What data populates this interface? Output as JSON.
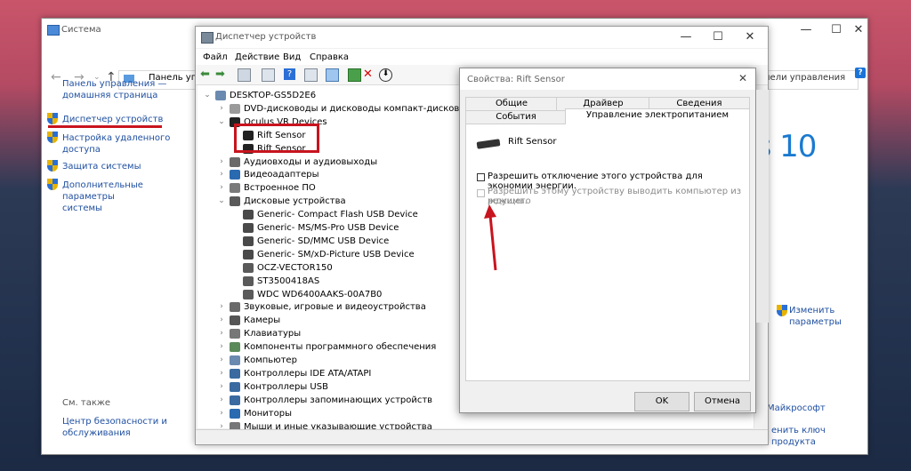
{
  "system": {
    "title": "Система",
    "address": "Панель упр",
    "search_fragment": "нели управления",
    "left_links": [
      "Панель управления —",
      "домашняя страница"
    ],
    "nav": [
      {
        "label1": "Диспетчер устройств",
        "label2": ""
      },
      {
        "label1": "Настройка удаленного",
        "label2": "доступа"
      },
      {
        "label1": "Защита системы",
        "label2": ""
      },
      {
        "label1": "Дополнительные параметры",
        "label2": "системы"
      }
    ],
    "see_also": "См. также",
    "bottom_link": [
      "Центр безопасности и",
      "обслуживания"
    ],
    "logo_text": "ows 10",
    "change_params": [
      "Изменить",
      "параметры"
    ],
    "microsoft_fragment": "Майкрософт",
    "product_key_fragment": "енить ключ продукта"
  },
  "devmgr": {
    "title": "Диспетчер устройств",
    "menu": [
      "Файл",
      "Действие",
      "Вид",
      "Справка"
    ],
    "tree": [
      {
        "label": "DESKTOP-GS5D2E6",
        "indent": 0,
        "expander": "expanded",
        "icon": "computer-icon"
      },
      {
        "label": "DVD-дисководы и дисководы компакт-дисков",
        "indent": 1,
        "expander": "collapsed",
        "icon": "dvd-drive-icon"
      },
      {
        "label": "Oculus VR Devices",
        "indent": 1,
        "expander": "expanded",
        "icon": "usb-device-icon"
      },
      {
        "label": "Rift Sensor",
        "indent": 2,
        "expander": "none",
        "icon": "usb-device-icon"
      },
      {
        "label": "Rift Sensor",
        "indent": 2,
        "expander": "none",
        "icon": "usb-device-icon"
      },
      {
        "label": "Аудиовходы и аудиовыходы",
        "indent": 1,
        "expander": "collapsed",
        "icon": "speaker-icon"
      },
      {
        "label": "Видеоадаптеры",
        "indent": 1,
        "expander": "collapsed",
        "icon": "display-adapter-icon"
      },
      {
        "label": "Встроенное ПО",
        "indent": 1,
        "expander": "collapsed",
        "icon": "firmware-icon"
      },
      {
        "label": "Дисковые устройства",
        "indent": 1,
        "expander": "expanded",
        "icon": "disk-drive-icon"
      },
      {
        "label": "Generic- Compact Flash USB Device",
        "indent": 2,
        "expander": "none",
        "icon": "usb-disk-icon"
      },
      {
        "label": "Generic- MS/MS-Pro USB Device",
        "indent": 2,
        "expander": "none",
        "icon": "usb-disk-icon"
      },
      {
        "label": "Generic- SD/MMC USB Device",
        "indent": 2,
        "expander": "none",
        "icon": "usb-disk-icon"
      },
      {
        "label": "Generic- SM/xD-Picture USB Device",
        "indent": 2,
        "expander": "none",
        "icon": "usb-disk-icon"
      },
      {
        "label": "OCZ-VECTOR150",
        "indent": 2,
        "expander": "none",
        "icon": "disk-drive-icon"
      },
      {
        "label": "ST3500418AS",
        "indent": 2,
        "expander": "none",
        "icon": "disk-drive-icon"
      },
      {
        "label": "WDC WD6400AAKS-00A7B0",
        "indent": 2,
        "expander": "none",
        "icon": "disk-drive-icon"
      },
      {
        "label": "Звуковые, игровые и видеоустройства",
        "indent": 1,
        "expander": "collapsed",
        "icon": "speaker-icon"
      },
      {
        "label": "Камеры",
        "indent": 1,
        "expander": "collapsed",
        "icon": "camera-icon"
      },
      {
        "label": "Клавиатуры",
        "indent": 1,
        "expander": "collapsed",
        "icon": "keyboard-icon"
      },
      {
        "label": "Компоненты программного обеспечения",
        "indent": 1,
        "expander": "collapsed",
        "icon": "software-component-icon"
      },
      {
        "label": "Компьютер",
        "indent": 1,
        "expander": "collapsed",
        "icon": "computer-icon"
      },
      {
        "label": "Контроллеры IDE ATA/ATAPI",
        "indent": 1,
        "expander": "collapsed",
        "icon": "controller-icon"
      },
      {
        "label": "Контроллеры USB",
        "indent": 1,
        "expander": "collapsed",
        "icon": "usb-controller-icon"
      },
      {
        "label": "Контроллеры запоминающих устройств",
        "indent": 1,
        "expander": "collapsed",
        "icon": "storage-controller-icon"
      },
      {
        "label": "Мониторы",
        "indent": 1,
        "expander": "collapsed",
        "icon": "monitor-icon"
      },
      {
        "label": "Мыши и иные указывающие устройства",
        "indent": 1,
        "expander": "collapsed",
        "icon": "mouse-icon"
      }
    ]
  },
  "props": {
    "title": "Свойства: Rift Sensor",
    "tabs_row1": [
      "Общие",
      "Драйвер",
      "Сведения"
    ],
    "tabs_row2": [
      "События",
      "Управление электропитанием"
    ],
    "device_name": "Rift Sensor",
    "allow_off": "Разрешить отключение этого устройства для экономии энергии.",
    "allow_wake_1": "Разрешить этому устройству выводить компьютер из ждущего",
    "allow_wake_2": "режима.",
    "ok": "OK",
    "cancel": "Отмена"
  }
}
